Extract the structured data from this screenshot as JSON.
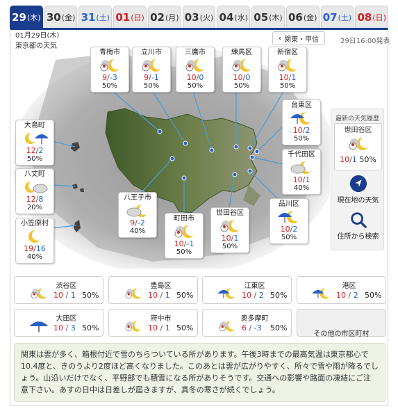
{
  "tabs": [
    {
      "num": "29",
      "dow": "(木)",
      "type": "active"
    },
    {
      "num": "30",
      "dow": "(金)",
      "type": "normal"
    },
    {
      "num": "31",
      "dow": "(土)",
      "type": "sat"
    },
    {
      "num": "01",
      "dow": "(日)",
      "type": "sun"
    },
    {
      "num": "02",
      "dow": "(月)",
      "type": "normal"
    },
    {
      "num": "03",
      "dow": "(火)",
      "type": "normal"
    },
    {
      "num": "04",
      "dow": "(水)",
      "type": "normal"
    },
    {
      "num": "05",
      "dow": "(木)",
      "type": "normal"
    },
    {
      "num": "06",
      "dow": "(金)",
      "type": "normal"
    },
    {
      "num": "07",
      "dow": "(土)",
      "type": "sat"
    },
    {
      "num": "08",
      "dow": "(日)",
      "type": "sun"
    }
  ],
  "header": {
    "date": "01月29日(木)",
    "subtitle": "東京都の天気",
    "region_button": "関東・甲信",
    "issued": "29日16:00発表"
  },
  "map_cards": {
    "oume": {
      "name": "青梅市",
      "high": "9",
      "low": "-3",
      "precip": "50%",
      "icon": "snow-cloud-moon-icon"
    },
    "tachikawa": {
      "name": "立川市",
      "high": "9",
      "low": "-1",
      "precip": "50%",
      "icon": "snow-cloud-moon-icon"
    },
    "mitaka": {
      "name": "三鷹市",
      "high": "10",
      "low": "0",
      "precip": "50%",
      "icon": "snow-cloud-moon-icon"
    },
    "nerima": {
      "name": "練馬区",
      "high": "10",
      "low": "0",
      "precip": "50%",
      "icon": "snow-cloud-moon-icon"
    },
    "shinjuku": {
      "name": "新宿区",
      "high": "10",
      "low": "1",
      "precip": "50%",
      "icon": "snow-cloud-moon-icon"
    },
    "taito": {
      "name": "台東区",
      "high": "10",
      "low": "2",
      "precip": "50%",
      "icon": "rain-cloud-moon-icon"
    },
    "chiyoda": {
      "name": "千代田区",
      "high": "10",
      "low": "1",
      "precip": "40%",
      "icon": "cloud-moon-icon"
    },
    "shinagawa": {
      "name": "品川区",
      "high": "10",
      "low": "2",
      "precip": "50%",
      "icon": "rain-cloud-moon-icon"
    },
    "setagaya": {
      "name": "世田谷区",
      "high": "10",
      "low": "1",
      "precip": "50%",
      "icon": "snow-cloud-moon-icon"
    },
    "machida": {
      "name": "町田市",
      "high": "10",
      "low": "-1",
      "precip": "50%",
      "icon": "snow-cloud-moon-icon"
    },
    "hachioji": {
      "name": "八王子市",
      "high": "9",
      "low": "-2",
      "precip": "40%",
      "icon": "cloud-moon-icon"
    },
    "oshima": {
      "name": "大島町",
      "high": "12",
      "low": "2",
      "precip": "50%",
      "icon": "rain-moon-icon"
    },
    "hachijo": {
      "name": "八丈町",
      "high": "12",
      "low": "8",
      "precip": "20%",
      "icon": "cloud-moon-icon"
    },
    "ogasawara": {
      "name": "小笠原村",
      "high": "19",
      "low": "16",
      "precip": "40%",
      "icon": "moon-icon"
    }
  },
  "sidebar": {
    "title": "最新の天気履歴",
    "history": {
      "name": "世田谷区",
      "high": "10",
      "low": "1",
      "precip": "50%"
    },
    "current_location": "現在地の天気",
    "address_search": "住所から検索"
  },
  "grid": {
    "shibuya": {
      "name": "渋谷区",
      "high": "10",
      "low": "1",
      "precip": "50%"
    },
    "toshima": {
      "name": "豊島区",
      "high": "10",
      "low": "1",
      "precip": "50%"
    },
    "koto": {
      "name": "江東区",
      "high": "10",
      "low": "2",
      "precip": "50%"
    },
    "minato": {
      "name": "港区",
      "high": "10",
      "low": "2",
      "precip": "50%"
    },
    "ota": {
      "name": "大田区",
      "high": "10",
      "low": "3",
      "precip": "50%"
    },
    "fuchu": {
      "name": "府中市",
      "high": "10",
      "low": "1",
      "precip": "50%"
    },
    "okutama": {
      "name": "奥多摩町",
      "high": "6",
      "low": "-3",
      "precip": "50%"
    },
    "more": "その他の市区町村"
  },
  "description": "関東は雲が多く、箱根付近で雪のちらついている所があります。午後3時までの最高気温は東京都心で10.4度と、きのうより2度ほど高くなりました。このあとは雲が広がりやすく、所々で雪や雨が降るでしょう。山沿いだけでなく、平野部でも積雪になる所がありそうです。交通への影響や路面の凍結にご注意下さい。あすの日中は日差しが届きますが、真冬の寒さが続くでしょう。",
  "colors": {
    "accent": "#1a3c8c",
    "high": "#d62020",
    "low": "#2060d0",
    "sat": "#2a5fd0",
    "sun": "#d02020"
  }
}
